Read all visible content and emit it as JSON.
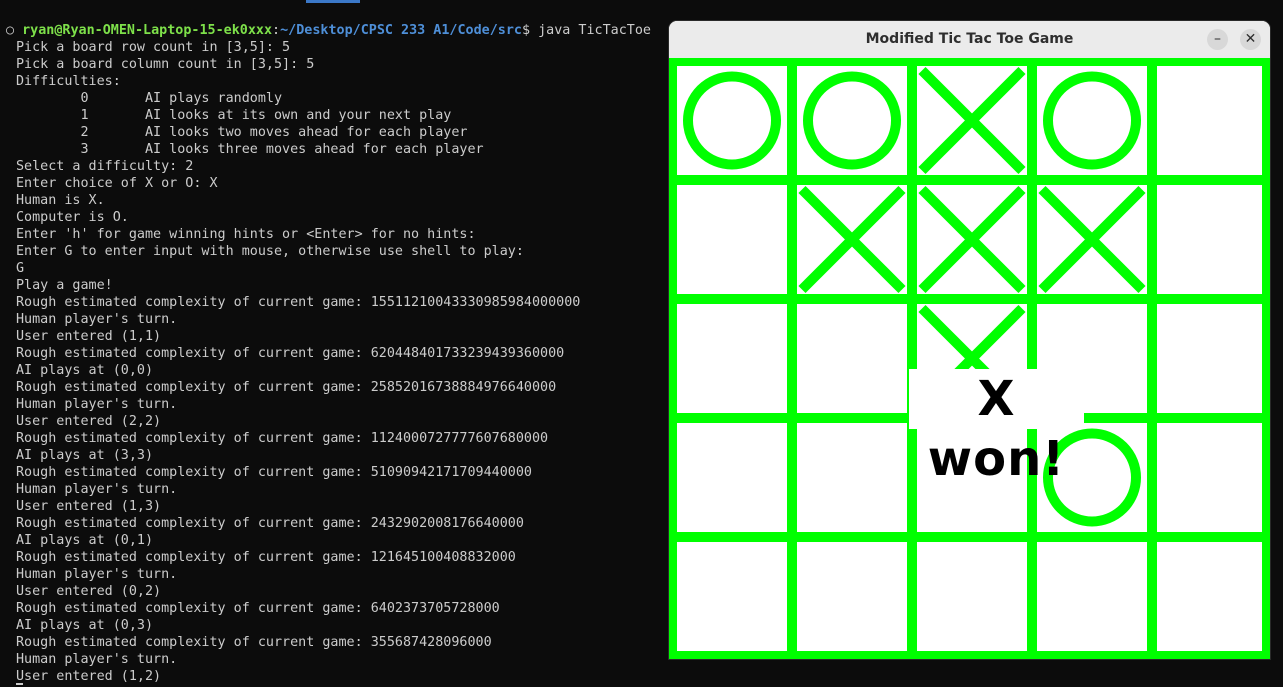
{
  "terminal": {
    "prompt_user": "ryan@Ryan-OMEN-Laptop-15-ek0xxx",
    "prompt_sep": ":",
    "prompt_path": "~/Desktop/CPSC 233 A1/Code/src",
    "prompt_dollar": "$",
    "prompt_command": " java TicTacToe",
    "lines": [
      "Pick a board row count in [3,5]: 5",
      "Pick a board column count in [3,5]: 5",
      "Difficulties:",
      "        0       AI plays randomly",
      "        1       AI looks at its own and your next play",
      "        2       AI looks two moves ahead for each player",
      "        3       AI looks three moves ahead for each player",
      "Select a difficulty: 2",
      "Enter choice of X or O: X",
      "Human is X.",
      "Computer is O.",
      "Enter 'h' for game winning hints or <Enter> for no hints:",
      "Enter G to enter input with mouse, otherwise use shell to play:",
      "G",
      "Play a game!",
      "Rough estimated complexity of current game: 15511210043330985984000000",
      "Human player's turn.",
      "User entered (1,1)",
      "Rough estimated complexity of current game: 620448401733239439360000",
      "AI plays at (0,0)",
      "Rough estimated complexity of current game: 25852016738884976640000",
      "Human player's turn.",
      "User entered (2,2)",
      "Rough estimated complexity of current game: 1124000727777607680000",
      "AI plays at (3,3)",
      "Rough estimated complexity of current game: 51090942171709440000",
      "Human player's turn.",
      "User entered (1,3)",
      "Rough estimated complexity of current game: 2432902008176640000",
      "AI plays at (0,1)",
      "Rough estimated complexity of current game: 121645100408832000",
      "Human player's turn.",
      "User entered (0,2)",
      "Rough estimated complexity of current game: 6402373705728000",
      "AI plays at (0,3)",
      "Rough estimated complexity of current game: 355687428096000",
      "Human player's turn.",
      "User entered (1,2)"
    ]
  },
  "game_window": {
    "title": "Modified Tic Tac Toe Game",
    "minimize_label": "–",
    "close_label": "✕",
    "result_text": "X won!",
    "board": {
      "rows": 5,
      "cols": 5,
      "line_color": "#00ff00",
      "cells": [
        [
          "O",
          "O",
          "X",
          "O",
          ""
        ],
        [
          "",
          "X",
          "X",
          "X",
          ""
        ],
        [
          "",
          "",
          "X",
          "",
          ""
        ],
        [
          "",
          "",
          "",
          "O",
          ""
        ],
        [
          "",
          "",
          "",
          "",
          ""
        ]
      ]
    }
  }
}
